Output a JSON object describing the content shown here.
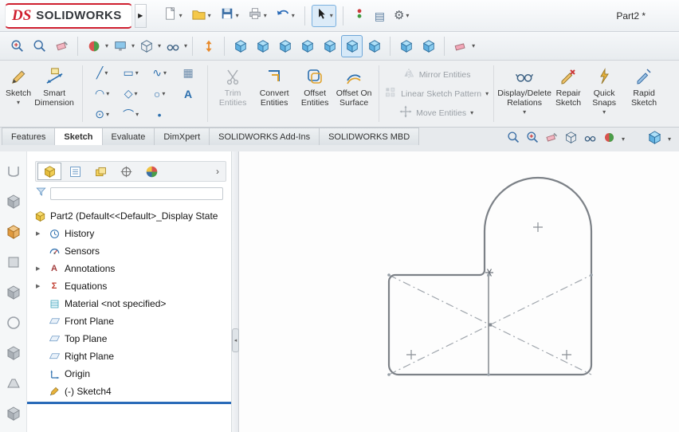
{
  "window": {
    "doc_title": "Part2 *"
  },
  "brand": {
    "logo": "DS",
    "name": "SOLIDWORKS"
  },
  "icons": {
    "caret": "▾",
    "menu_expand": "▶",
    "tree_arrow": "▶",
    "gear": "⚙",
    "list": "▤",
    "chevron_right": "›",
    "grid": "▦",
    "line": "╱",
    "rect": "▭",
    "spline": "∿",
    "arc": "◠",
    "polygon": "◇",
    "circle": "○",
    "text_tool": "A",
    "ellipse": "⊙",
    "fillet": "⌒",
    "point": "•",
    "sigma": "Σ",
    "annotation_a": "A",
    "collapse_left": "◂"
  },
  "ribbon": {
    "sketch": "Sketch",
    "smart_dimension": "Smart Dimension",
    "trim": "Trim Entities",
    "convert": "Convert Entities",
    "offset": "Offset Entities",
    "offset_surface": "Offset On Surface",
    "mirror": "Mirror Entities",
    "linear_pattern": "Linear Sketch Pattern",
    "move": "Move Entities",
    "display_relations": "Display/Delete Relations",
    "repair": "Repair Sketch",
    "quick_snaps": "Quick Snaps",
    "rapid_sketch": "Rapid Sketch"
  },
  "tabs": {
    "items": [
      {
        "label": "Features",
        "active": false
      },
      {
        "label": "Sketch",
        "active": true
      },
      {
        "label": "Evaluate",
        "active": false
      },
      {
        "label": "DimXpert",
        "active": false
      },
      {
        "label": "SOLIDWORKS Add-Ins",
        "active": false
      },
      {
        "label": "SOLIDWORKS MBD",
        "active": false
      }
    ]
  },
  "tree": {
    "root": "Part2 (Default<<Default>_Display State",
    "items": [
      {
        "label": "History",
        "expandable": true
      },
      {
        "label": "Sensors",
        "expandable": false
      },
      {
        "label": "Annotations",
        "expandable": true
      },
      {
        "label": "Equations",
        "expandable": true
      },
      {
        "label": "Material <not specified>",
        "expandable": false
      },
      {
        "label": "Front Plane",
        "expandable": false
      },
      {
        "label": "Top Plane",
        "expandable": false
      },
      {
        "label": "Right Plane",
        "expandable": false
      },
      {
        "label": "Origin",
        "expandable": false
      },
      {
        "label": "(-) Sketch4",
        "expandable": false
      }
    ]
  }
}
